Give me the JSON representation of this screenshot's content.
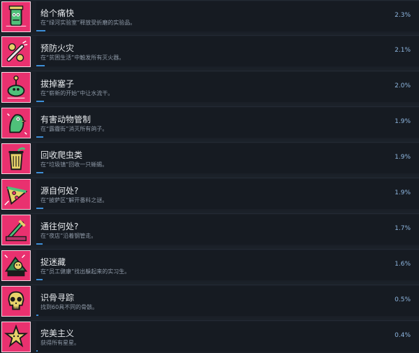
{
  "achievements": [
    {
      "title": "给个痛快",
      "desc": "在“绿河实验室”释放受折磨的实验品。",
      "percent": "2.3%",
      "rate": 0.023,
      "icon": "monster-jar-icon"
    },
    {
      "title": "预防火灾",
      "desc": "在“贫困生活”中触发所有灭火器。",
      "percent": "2.1%",
      "rate": 0.021,
      "icon": "fire-extinguisher-icon"
    },
    {
      "title": "拔掉塞子",
      "desc": "在“崭新的开始”中让水流干。",
      "percent": "2.0%",
      "rate": 0.02,
      "icon": "drain-plug-icon"
    },
    {
      "title": "有害动物管制",
      "desc": "在“露霾街”消灭所有鸽子。",
      "percent": "1.9%",
      "rate": 0.019,
      "icon": "pigeon-icon"
    },
    {
      "title": "回收爬虫类",
      "desc": "在“垃圾镇”回收一只蜥蜴。",
      "percent": "1.9%",
      "rate": 0.019,
      "icon": "trash-can-lizard-icon"
    },
    {
      "title": "源自何处?",
      "desc": "在“披萨区”解开番料之谜。",
      "percent": "1.9%",
      "rate": 0.019,
      "icon": "pizza-slice-icon"
    },
    {
      "title": "通往何处?",
      "desc": "在“夜店”沿着钢管走。",
      "percent": "1.7%",
      "rate": 0.017,
      "icon": "pipe-icon"
    },
    {
      "title": "捉迷藏",
      "desc": "在“员工健康”找出躲起来的实习生。",
      "percent": "1.6%",
      "rate": 0.016,
      "icon": "hidden-intern-icon"
    },
    {
      "title": "识骨寻踪",
      "desc": "找到60具不同的骨骸。",
      "percent": "0.5%",
      "rate": 0.005,
      "icon": "skull-icon"
    },
    {
      "title": "完美主义",
      "desc": "获得所有星星。",
      "percent": "0.4%",
      "rate": 0.004,
      "icon": "star-icon"
    }
  ]
}
